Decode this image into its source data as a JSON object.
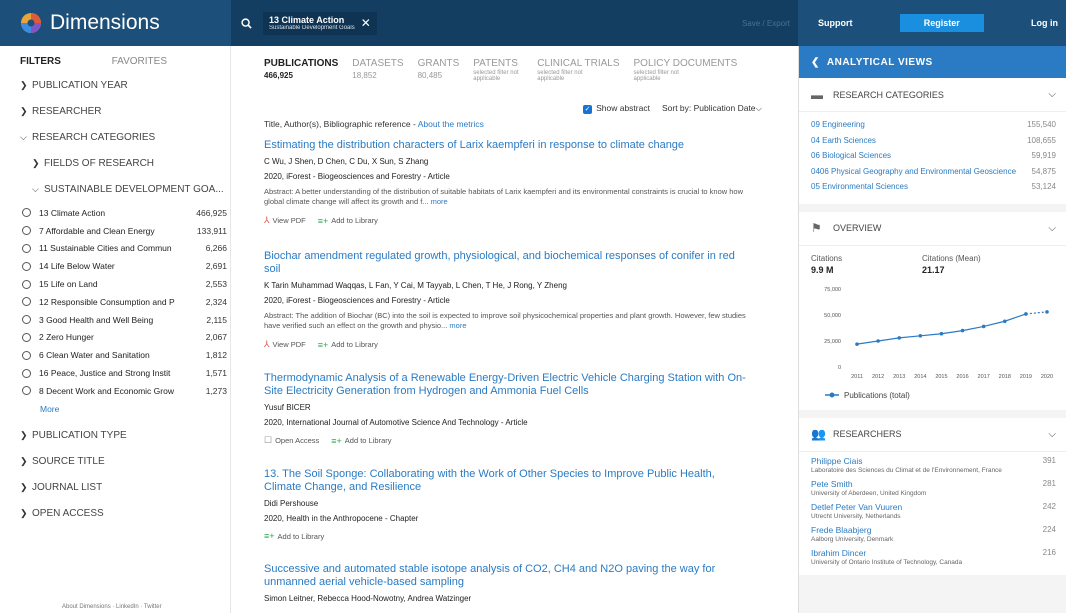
{
  "brand": {
    "name": "Dimensions"
  },
  "search": {
    "chip_title": "13 Climate Action",
    "chip_sub": "Sustainable Development Goals",
    "save_export": "Save / Export"
  },
  "topnav": {
    "support": "Support",
    "register": "Register",
    "login": "Log in"
  },
  "sidebar": {
    "tab_filters": "FILTERS",
    "tab_favorites": "FAVORITES",
    "publication_year": "PUBLICATION YEAR",
    "researcher": "RESEARCHER",
    "research_categories": "RESEARCH CATEGORIES",
    "fields_of_research": "FIELDS OF RESEARCH",
    "sdg_header": "SUSTAINABLE DEVELOPMENT GOA...",
    "sdgs": [
      {
        "label": "13 Climate Action",
        "count": "466,925"
      },
      {
        "label": "7 Affordable and Clean Energy",
        "count": "133,911"
      },
      {
        "label": "11 Sustainable Cities and Commun",
        "count": "6,266"
      },
      {
        "label": "14 Life Below Water",
        "count": "2,691"
      },
      {
        "label": "15 Life on Land",
        "count": "2,553"
      },
      {
        "label": "12 Responsible Consumption and P",
        "count": "2,324"
      },
      {
        "label": "3 Good Health and Well Being",
        "count": "2,115"
      },
      {
        "label": "2 Zero Hunger",
        "count": "2,067"
      },
      {
        "label": "6 Clean Water and Sanitation",
        "count": "1,812"
      },
      {
        "label": "16 Peace, Justice and Strong Instit",
        "count": "1,571"
      },
      {
        "label": "8 Decent Work and Economic Grow",
        "count": "1,273"
      }
    ],
    "more": "More",
    "publication_type": "PUBLICATION TYPE",
    "source_title": "SOURCE TITLE",
    "journal_list": "JOURNAL LIST",
    "open_access": "OPEN ACCESS",
    "footer": "About Dimensions · LinkedIn · Twitter"
  },
  "main": {
    "tabs": [
      {
        "label": "PUBLICATIONS",
        "count": "466,925",
        "note": ""
      },
      {
        "label": "DATASETS",
        "count": "18,852",
        "note": ""
      },
      {
        "label": "GRANTS",
        "count": "80,485",
        "note": ""
      },
      {
        "label": "PATENTS",
        "count": "",
        "note": "selected filter not applicable"
      },
      {
        "label": "CLINICAL TRIALS",
        "count": "",
        "note": "selected filter not applicable"
      },
      {
        "label": "POLICY DOCUMENTS",
        "count": "",
        "note": "selected filter not applicable"
      }
    ],
    "show_abstract": "Show abstract",
    "sort_by": "Sort by:",
    "sort_value": "Publication Date",
    "biblio": "Title, Author(s), Bibliographic reference -",
    "about_metrics": "About the metrics",
    "view_pdf": "View PDF",
    "add_library": "Add to Library",
    "open_access": "Open Access",
    "more": "more",
    "results": [
      {
        "title": "Estimating the distribution characters of Larix kaempferi in response to climate change",
        "authors": "C Wu, J Shen, D Chen, C Du, X Sun, S Zhang",
        "source": "2020, iForest - Biogeosciences and Forestry - Article",
        "abstract": "Abstract: A better understanding of the distribution of suitable habitats of Larix kaempferi and its environmental constraints is crucial to know how global climate change will affect its growth and f..."
      },
      {
        "title": "Biochar amendment regulated growth, physiological, and biochemical responses of conifer in red soil",
        "authors": "K Tarin Muhammad Waqqas, L Fan, Y Cai, M Tayyab, L Chen, T He, J Rong, Y Zheng",
        "source": "2020, iForest - Biogeosciences and Forestry - Article",
        "abstract": "Abstract: The addition of Biochar (BC) into the soil is expected to improve soil physicochemical properties and plant growth. However, few studies have verified such an effect on the growth and physio..."
      },
      {
        "title": "Thermodynamic Analysis of a Renewable Energy-Driven Electric Vehicle Charging Station with On-Site Electricity Generation from Hydrogen and Ammonia Fuel Cells",
        "authors": "Yusuf BICER",
        "source": "2020, International Journal of Automotive Science And Technology - Article",
        "abstract": ""
      },
      {
        "title": "13. The Soil Sponge: Collaborating with the Work of Other Species to Improve Public Health, Climate Change, and Resilience",
        "authors": "Didi Pershouse",
        "source": "2020, Health in the Anthropocene - Chapter",
        "abstract": ""
      },
      {
        "title": "Successive and automated stable isotope analysis of CO2, CH4 and N2O paving the way for unmanned aerial vehicle-based sampling",
        "authors": "Simon Leitner, Rebecca Hood-Nowotny, Andrea Watzinger",
        "source": "",
        "abstract": ""
      }
    ]
  },
  "right": {
    "header": "ANALYTICAL VIEWS",
    "research_categories_title": "RESEARCH CATEGORIES",
    "categories": [
      {
        "label": "09 Engineering",
        "count": "155,540"
      },
      {
        "label": "04 Earth Sciences",
        "count": "108,655"
      },
      {
        "label": "06 Biological Sciences",
        "count": "59,919"
      },
      {
        "label": "0406 Physical Geography and Environmental Geoscience",
        "count": "54,875"
      },
      {
        "label": "05 Environmental Sciences",
        "count": "53,124"
      }
    ],
    "overview_title": "OVERVIEW",
    "citations_label": "Citations",
    "citations_value": "9.9 M",
    "citations_mean_label": "Citations (Mean)",
    "citations_mean_value": "21.17",
    "researchers_title": "RESEARCHERS",
    "researchers": [
      {
        "name": "Philippe Ciais",
        "inst": "Laboratoire des Sciences du Climat et de l'Environnement, France",
        "count": "391"
      },
      {
        "name": "Pete Smith",
        "inst": "University of Aberdeen, United Kingdom",
        "count": "281"
      },
      {
        "name": "Detlef Peter Van Vuuren",
        "inst": "Utrecht University, Netherlands",
        "count": "242"
      },
      {
        "name": "Frede Blaabjerg",
        "inst": "Aalborg University, Denmark",
        "count": "224"
      },
      {
        "name": "Ibrahim Dincer",
        "inst": "University of Ontario Institute of Technology, Canada",
        "count": "216"
      }
    ]
  },
  "colors": {
    "topbar": "#1c4f79",
    "link": "#2a7bc4",
    "accent": "#1a8fe0"
  },
  "chart_data": {
    "type": "line",
    "x": [
      "2011",
      "2012",
      "2013",
      "2014",
      "2015",
      "2016",
      "2017",
      "2018",
      "2019",
      "2020"
    ],
    "series": [
      {
        "name": "Publications (total)",
        "values": [
          22000,
          25000,
          28000,
          30000,
          32000,
          35000,
          39000,
          44000,
          51000,
          53000
        ]
      }
    ],
    "yticks": [
      "0",
      "25,000",
      "50,000",
      "75,000"
    ],
    "ylim": [
      0,
      75000
    ],
    "grid": false,
    "legend": "bottom-left"
  }
}
